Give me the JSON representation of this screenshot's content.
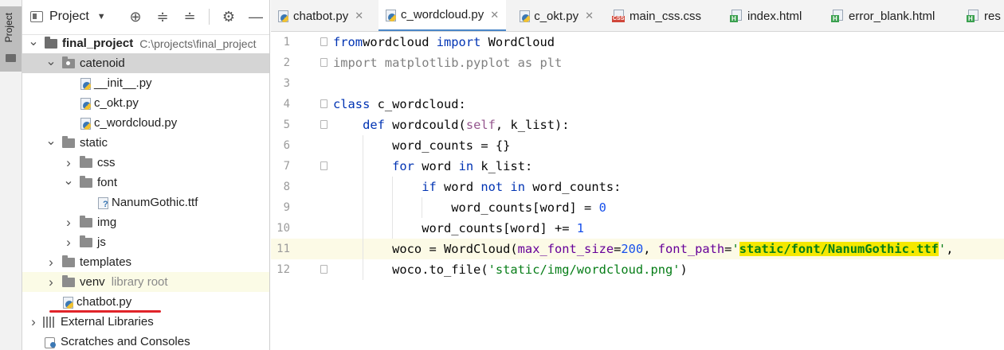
{
  "toolstrip": {
    "project_label": "Project"
  },
  "panel": {
    "title": "Project",
    "tree": [
      {
        "depth": 0,
        "chev": "down",
        "icon": "root-folder",
        "label": "final_project",
        "bold": true,
        "path": "C:\\projects\\final_project"
      },
      {
        "depth": 1,
        "chev": "down",
        "icon": "package-folder",
        "label": "catenoid",
        "selected": true
      },
      {
        "depth": 2,
        "chev": "",
        "icon": "python-file",
        "label": "__init__.py"
      },
      {
        "depth": 2,
        "chev": "",
        "icon": "python-file",
        "label": "c_okt.py"
      },
      {
        "depth": 2,
        "chev": "",
        "icon": "python-file",
        "label": "c_wordcloud.py"
      },
      {
        "depth": 1,
        "chev": "down",
        "icon": "folder",
        "label": "static"
      },
      {
        "depth": 2,
        "chev": "right",
        "icon": "folder",
        "label": "css"
      },
      {
        "depth": 2,
        "chev": "down",
        "icon": "folder",
        "label": "font"
      },
      {
        "depth": 3,
        "chev": "",
        "icon": "unknown-file",
        "label": "NanumGothic.ttf"
      },
      {
        "depth": 2,
        "chev": "right",
        "icon": "folder",
        "label": "img"
      },
      {
        "depth": 2,
        "chev": "right",
        "icon": "folder",
        "label": "js"
      },
      {
        "depth": 1,
        "chev": "right",
        "icon": "folder",
        "label": "templates"
      },
      {
        "depth": 1,
        "chev": "right",
        "icon": "folder",
        "label": "venv",
        "hint": "library root",
        "libroot": true
      },
      {
        "depth": 1,
        "chev": "",
        "icon": "python-file",
        "label": "chatbot.py"
      },
      {
        "depth": 0,
        "chev": "right",
        "icon": "library",
        "label": "External Libraries"
      },
      {
        "depth": 0,
        "chev": "",
        "icon": "scratch",
        "label": "Scratches and Consoles"
      }
    ]
  },
  "tabs": [
    {
      "label": "chatbot.py",
      "icon": "python-file",
      "closable": true,
      "active": false
    },
    {
      "label": "c_wordcloud.py",
      "icon": "python-file",
      "closable": true,
      "active": true
    },
    {
      "label": "c_okt.py",
      "icon": "python-file",
      "closable": true,
      "active": false
    },
    {
      "label": "main_css.css",
      "icon": "css-file",
      "closable": false,
      "active": false
    },
    {
      "label": "index.html",
      "icon": "html-file",
      "closable": false,
      "active": false
    },
    {
      "label": "error_blank.html",
      "icon": "html-file",
      "closable": false,
      "active": false
    },
    {
      "label": "res",
      "icon": "html-file",
      "closable": false,
      "active": false
    }
  ],
  "editor": {
    "current_line": 11,
    "lines": [
      {
        "n": "1",
        "tokens": [
          [
            "kw",
            "from"
          ],
          [
            "",
            "wordcloud "
          ],
          [
            "kw",
            "import"
          ],
          [
            "",
            " WordCloud"
          ]
        ]
      },
      {
        "n": "2",
        "tokens": [
          [
            "mod",
            "import matplotlib.pyplot as plt"
          ]
        ]
      },
      {
        "n": "3",
        "tokens": []
      },
      {
        "n": "4",
        "tokens": [
          [
            "kw",
            "class"
          ],
          [
            "",
            " c_wordcloud:"
          ]
        ]
      },
      {
        "n": "5",
        "tokens": [
          [
            "",
            "    "
          ],
          [
            "kw",
            "def"
          ],
          [
            "",
            " wordcould("
          ],
          [
            "self",
            "self"
          ],
          [
            "",
            ", k_list):"
          ]
        ]
      },
      {
        "n": "6",
        "tokens": [
          [
            "",
            "        word_counts = {}"
          ]
        ]
      },
      {
        "n": "7",
        "tokens": [
          [
            "",
            "        "
          ],
          [
            "kw",
            "for"
          ],
          [
            "",
            " word "
          ],
          [
            "kw",
            "in"
          ],
          [
            "",
            " k_list:"
          ]
        ]
      },
      {
        "n": "8",
        "tokens": [
          [
            "",
            "            "
          ],
          [
            "kw",
            "if"
          ],
          [
            "",
            " word "
          ],
          [
            "kw",
            "not in"
          ],
          [
            "",
            " word_counts:"
          ]
        ]
      },
      {
        "n": "9",
        "tokens": [
          [
            "",
            "                word_counts[word] = "
          ],
          [
            "num",
            "0"
          ]
        ]
      },
      {
        "n": "10",
        "tokens": [
          [
            "",
            "            word_counts[word] += "
          ],
          [
            "num",
            "1"
          ]
        ]
      },
      {
        "n": "11",
        "tokens": [
          [
            "",
            "        woco = WordCloud("
          ],
          [
            "param",
            "max_font_size"
          ],
          [
            "",
            "="
          ],
          [
            "num",
            "200"
          ],
          [
            "",
            ", "
          ],
          [
            "param",
            "font_path"
          ],
          [
            "",
            "="
          ],
          [
            "str",
            "'"
          ],
          [
            "hl-str",
            "static/font/NanumGothic.ttf"
          ],
          [
            "str",
            "'"
          ],
          [
            "",
            ","
          ]
        ]
      },
      {
        "n": "12",
        "tokens": [
          [
            "",
            "        woco.to_file("
          ],
          [
            "str",
            "'static/img/wordcloud.png'"
          ],
          [
            "",
            ")"
          ]
        ]
      }
    ]
  }
}
